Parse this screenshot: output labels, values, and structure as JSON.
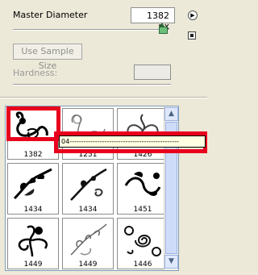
{
  "panel": {
    "master_diameter_label": "Master Diameter",
    "master_diameter_value": "1382 px",
    "sample_size_button": "Use Sample Size",
    "hardness_label": "Hardness:",
    "master_diameter_slider_fraction": 0.96
  },
  "brushes": [
    {
      "name": "1382",
      "selected": true
    },
    {
      "name": "1251"
    },
    {
      "name": "1426"
    },
    {
      "name": "1434"
    },
    {
      "name": "1434"
    },
    {
      "name": "1451"
    },
    {
      "name": "1449"
    },
    {
      "name": "1449"
    },
    {
      "name": "1446"
    }
  ],
  "tooltip": {
    "text": "04-----------------------------------------------"
  },
  "colors": {
    "panel_bg": "#ece9d8",
    "highlight": "#e8001c",
    "slider_handle": "#6bbf7a"
  },
  "icons": [
    "panel-menu-arrow-icon",
    "new-preset-icon",
    "scroll-up-icon",
    "scroll-down-icon"
  ]
}
